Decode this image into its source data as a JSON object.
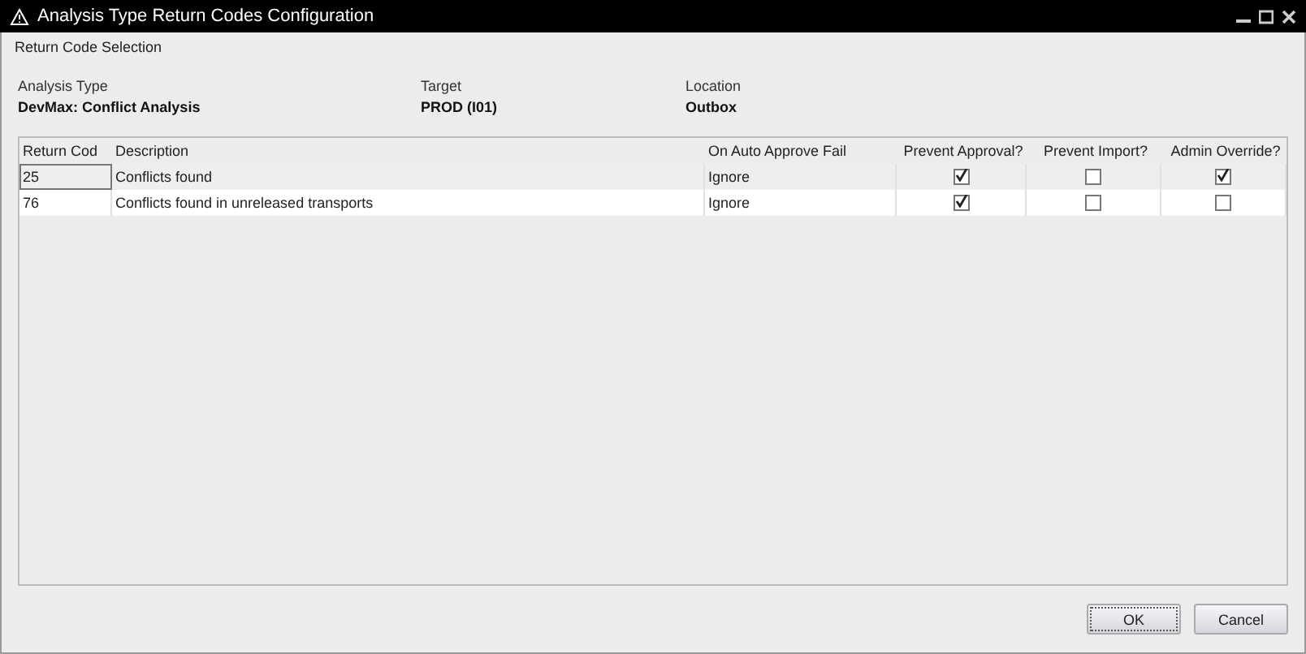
{
  "window": {
    "title": "Analysis Type Return Codes Configuration"
  },
  "section_title": "Return Code Selection",
  "info": [
    {
      "label": "Analysis Type",
      "value": "DevMax: Conflict Analysis"
    },
    {
      "label": "Target",
      "value": "PROD (I01)"
    },
    {
      "label": "Location",
      "value": "Outbox"
    }
  ],
  "table": {
    "columns": [
      "Return Cod",
      "Description",
      "On Auto Approve Fail",
      "Prevent Approval?",
      "Prevent Import?",
      "Admin Override?"
    ],
    "rows": [
      {
        "selected": true,
        "code": "25",
        "description": "Conflicts found",
        "on_fail": "Ignore",
        "prevent_approval": true,
        "prevent_import": false,
        "admin_override": true
      },
      {
        "selected": false,
        "code": "76",
        "description": "Conflicts found in unreleased transports",
        "on_fail": "Ignore",
        "prevent_approval": true,
        "prevent_import": false,
        "admin_override": false
      }
    ]
  },
  "buttons": [
    {
      "label": "OK",
      "focused": true
    },
    {
      "label": "Cancel",
      "focused": false
    }
  ]
}
